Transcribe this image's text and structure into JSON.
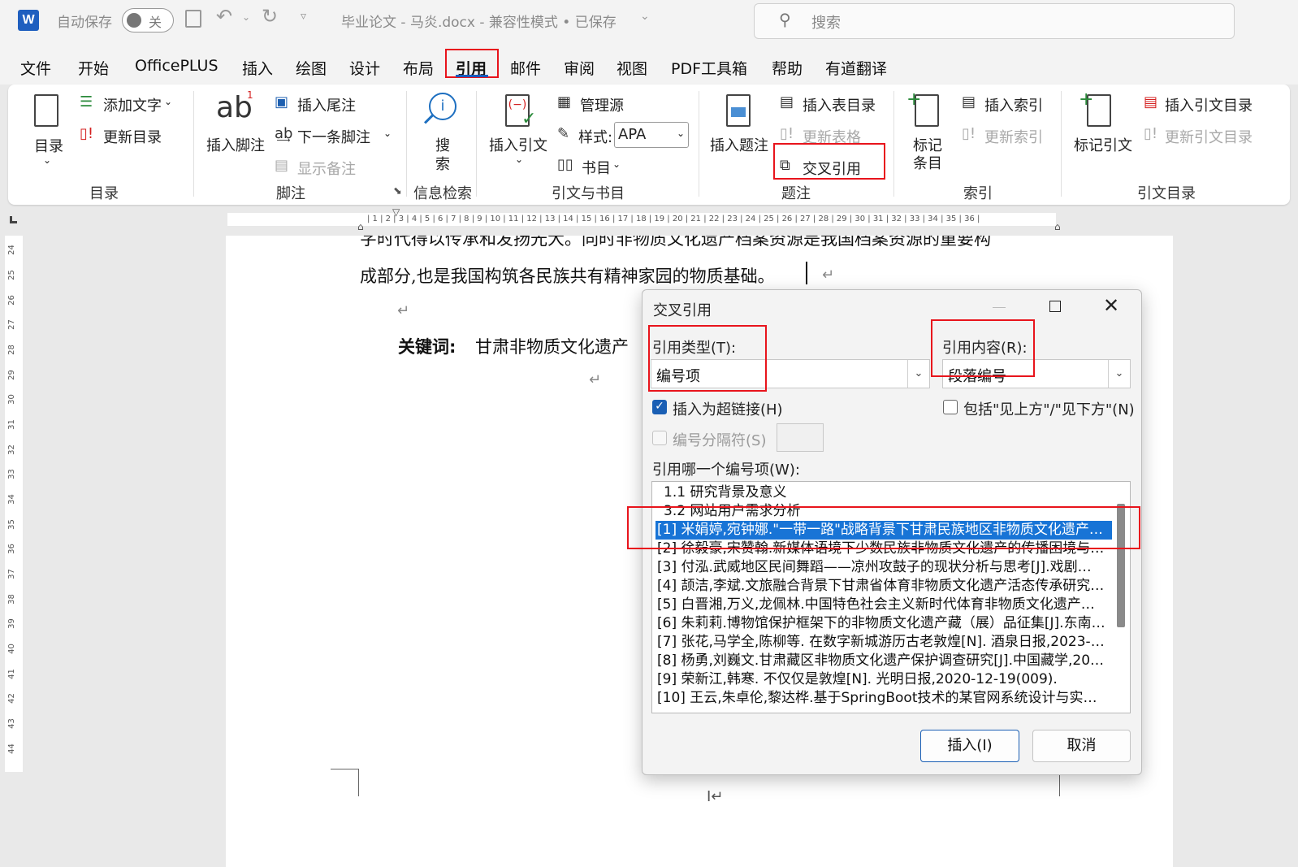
{
  "titlebar": {
    "app_letter": "W",
    "autosave_label": "自动保存",
    "autosave_state": "关",
    "document": "毕业论文 - 马炎.docx  -  兼容性模式 • 已保存",
    "search_placeholder": "搜索"
  },
  "menu": {
    "tabs": [
      "文件",
      "开始",
      "OfficePLUS",
      "插入",
      "绘图",
      "设计",
      "布局",
      "引用",
      "邮件",
      "审阅",
      "视图",
      "PDF工具箱",
      "帮助",
      "有道翻译"
    ],
    "active": "引用"
  },
  "ribbon": {
    "toc": {
      "big": "目录",
      "add_text": "添加文字",
      "update_toc": "更新目录",
      "group": "目录"
    },
    "footnotes": {
      "insert_footnote": "插入脚注",
      "ab": "ab",
      "sup": "1",
      "insert_endnote": "插入尾注",
      "next_footnote": "下一条脚注",
      "show_notes": "显示备注",
      "group": "脚注"
    },
    "research": {
      "search": "搜\n索",
      "search_1": "搜",
      "search_2": "索",
      "group": "信息检索"
    },
    "citations": {
      "insert_citation": "插入引文",
      "manage_sources": "管理源",
      "style_label": "样式:",
      "style_value": "APA",
      "bibliography": "书目",
      "group": "引文与书目"
    },
    "captions": {
      "insert_caption": "插入题注",
      "insert_table_of_figures": "插入表目录",
      "update_table": "更新表格",
      "cross_reference": "交叉引用",
      "group": "题注"
    },
    "index": {
      "mark_entry_1": "标记",
      "mark_entry_2": "条目",
      "insert_index": "插入索引",
      "update_index": "更新索引",
      "group": "索引"
    },
    "toa": {
      "mark_citation": "标记引文",
      "insert_toa": "插入引文目录",
      "update_toa": "更新引文目录",
      "group": "引文目录"
    }
  },
  "ruler": {
    "h_ticks": "| 1 | 2 | 3 | 4 | 5 | 6 | 7 | 8 | 9 | 10 | 11 | 12 | 13 | 14 | 15 | 16 | 17 | 18 | 19 | 20 | 21 | 22 | 23 | 24 | 25 | 26 | 27 | 28 | 29 | 30 | 31 | 32 | 33 | 34 | 35 | 36 |",
    "v_ticks": [
      "24",
      "25",
      "26",
      "27",
      "28",
      "29",
      "30",
      "31",
      "32",
      "33",
      "34",
      "35",
      "36",
      "37",
      "38",
      "39",
      "40",
      "41",
      "42",
      "43",
      "44"
    ]
  },
  "document": {
    "line1": "字时代得以传承和发扬光大。同时非物质文化遗产档案资源是我国档案资源的重要构",
    "line2": "成部分,也是我国构筑各民族共有精神家园的物质基础。",
    "keywords_label": "关键词:",
    "keywords_value": "甘肃非物质文化遗产",
    "para_mark": "↵",
    "cursor_mark": "I↵"
  },
  "dialog": {
    "title": "交叉引用",
    "ref_type_label": "引用类型(T):",
    "ref_type_value": "编号项",
    "ref_content_label": "引用内容(R):",
    "ref_content_value": "段落编号",
    "insert_hyperlink": "插入为超链接(H)",
    "insert_hyperlink_checked": true,
    "include_above_below": "包括\"见上方\"/\"见下方\"(N)",
    "include_above_below_checked": false,
    "separate_numbers": "编号分隔符(S)",
    "which_label": "引用哪一个编号项(W):",
    "items": [
      "1.1 研究背景及意义",
      "3.2 网站用户需求分析",
      "[1] 米娟婷,宛钟娜.\"一带一路\"战略背景下甘肃民族地区非物质文化遗产…",
      "[2] 徐毅豪,宋赞翰.新媒体语境下少数民族非物质文化遗产的传播困境与…",
      "[3] 付泓.武威地区民间舞蹈——凉州攻鼓子的现状分析与思考[J].戏剧…",
      "[4] 颉洁,李斌.文旅融合背景下甘肃省体育非物质文化遗产活态传承研究…",
      "[5] 白晋湘,万义,龙佩林.中国特色社会主义新时代体育非物质文化遗产…",
      "[6] 朱莉莉.博物馆保护框架下的非物质文化遗产藏（展）品征集[J].东南…",
      "[7] 张花,马学全,陈柳等. 在数字新城游历古老敦煌[N]. 酒泉日报,2023-…",
      "[8] 杨勇,刘巍文.甘肃藏区非物质文化遗产保护调查研究[J].中国藏学,20…",
      "[9] 荣新江,韩寒. 不仅仅是敦煌[N]. 光明日报,2020-12-19(009).",
      "[10] 王云,朱卓伦,黎达桦.基于SpringBoot技术的某官网系统设计与实…"
    ],
    "selected_index": 2,
    "insert_button": "插入(I)",
    "cancel_button": "取消"
  },
  "colors": {
    "highlight_red": "#e8141c",
    "selection_blue": "#1874d6",
    "word_blue": "#185abd"
  }
}
